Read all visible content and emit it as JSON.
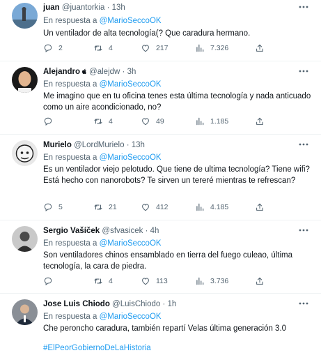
{
  "reply_prefix": "En respuesta a",
  "reply_to": "@MarioSeccoOK",
  "tweets": [
    {
      "name": "juan",
      "handle": "@juantorkia",
      "time": "13h",
      "text": "Un ventilador de alta tecnología(? Que caradura hermano.",
      "replies": "2",
      "retweets": "4",
      "likes": "217",
      "views": "7.326"
    },
    {
      "name": "Alejandro",
      "handle": "@alejdw",
      "time": "3h",
      "text": "Me imagino que en tu oficina tenes esta última tecnología y nada anticuado como un aire acondicionado, no?",
      "replies": "",
      "retweets": "4",
      "likes": "49",
      "views": "1.185"
    },
    {
      "name": "Murielo",
      "handle": "@LordMurielo",
      "time": "13h",
      "text": "Es un ventilador viejo pelotudo. Que tiene de ultima tecnología? Tiene wifi? Está hecho con nanorobots? Te sirven un tereré mientras te refrescan?",
      "replies": "5",
      "retweets": "21",
      "likes": "412",
      "views": "4.185"
    },
    {
      "name": "Sergio Vašíček",
      "handle": "@sfvasicek",
      "time": "4h",
      "text": "Son ventiladores chinos ensamblado en tierra del fuego culeao, última tecnología, la cara de piedra.",
      "replies": "",
      "retweets": "4",
      "likes": "113",
      "views": "3.736"
    },
    {
      "name": "Jose Luis Chiodo",
      "handle": "@LuisChiodo",
      "time": "1h",
      "text": "Che peroncho caradura, también repartí Velas última generación 3.0",
      "hashtag": "#ElPeorGobiernoDeLaHistoria"
    }
  ],
  "colors": {
    "accent": "#1d9bf0",
    "muted": "#536471",
    "text": "#0f1419",
    "divider": "#eff3f4"
  },
  "icons": [
    "reply-icon",
    "retweet-icon",
    "like-icon",
    "views-icon",
    "share-icon",
    "more-icon",
    "apple-icon"
  ]
}
